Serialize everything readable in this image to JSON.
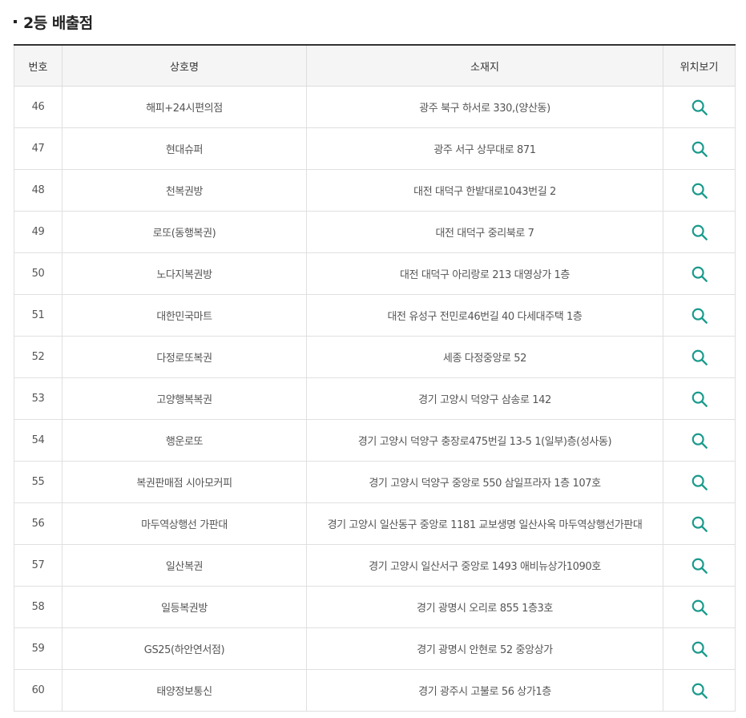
{
  "section": {
    "title": "2등 배출점"
  },
  "table": {
    "headers": {
      "no": "번호",
      "name": "상호명",
      "address": "소재지",
      "location": "위치보기"
    },
    "rows": [
      {
        "no": "46",
        "name": "해피+24시편의점",
        "address": "광주 북구 하서로 330,(양산동)"
      },
      {
        "no": "47",
        "name": "현대슈퍼",
        "address": "광주 서구 상무대로 871"
      },
      {
        "no": "48",
        "name": "천복권방",
        "address": "대전 대덕구 한밭대로1043번길 2"
      },
      {
        "no": "49",
        "name": "로또(동행복권)",
        "address": "대전 대덕구 중리북로 7"
      },
      {
        "no": "50",
        "name": "노다지복권방",
        "address": "대전 대덕구 아리랑로 213 대영상가 1층"
      },
      {
        "no": "51",
        "name": "대한민국마트",
        "address": "대전 유성구 전민로46번길 40 다세대주택 1층"
      },
      {
        "no": "52",
        "name": "다정로또복권",
        "address": "세종 다정중앙로 52"
      },
      {
        "no": "53",
        "name": "고양행복복권",
        "address": "경기 고양시 덕양구 삼송로 142"
      },
      {
        "no": "54",
        "name": "행운로또",
        "address": "경기 고양시 덕양구 충장로475번길 13-5 1(일부)층(성사동)"
      },
      {
        "no": "55",
        "name": "복권판매점 시아모커피",
        "address": "경기 고양시 덕양구 중앙로 550 삼일프라자 1층 107호"
      },
      {
        "no": "56",
        "name": "마두역상행선 가판대",
        "address": "경기 고양시 일산동구 중앙로 1181 교보생명 일산사옥 마두역상행선가판대"
      },
      {
        "no": "57",
        "name": "일산복권",
        "address": "경기 고양시 일산서구 중앙로 1493 애비뉴상가1090호"
      },
      {
        "no": "58",
        "name": "일등복권방",
        "address": "경기 광명시 오리로 855 1층3호"
      },
      {
        "no": "59",
        "name": "GS25(하안연서점)",
        "address": "경기 광명시 안현로 52 중앙상가"
      },
      {
        "no": "60",
        "name": "태양정보통신",
        "address": "경기 광주시 고불로 56 상가1층"
      }
    ]
  },
  "icons": {
    "location": "search-icon"
  },
  "colors": {
    "icon": "#1a9a8c",
    "header_bg": "#f5f5f5"
  }
}
